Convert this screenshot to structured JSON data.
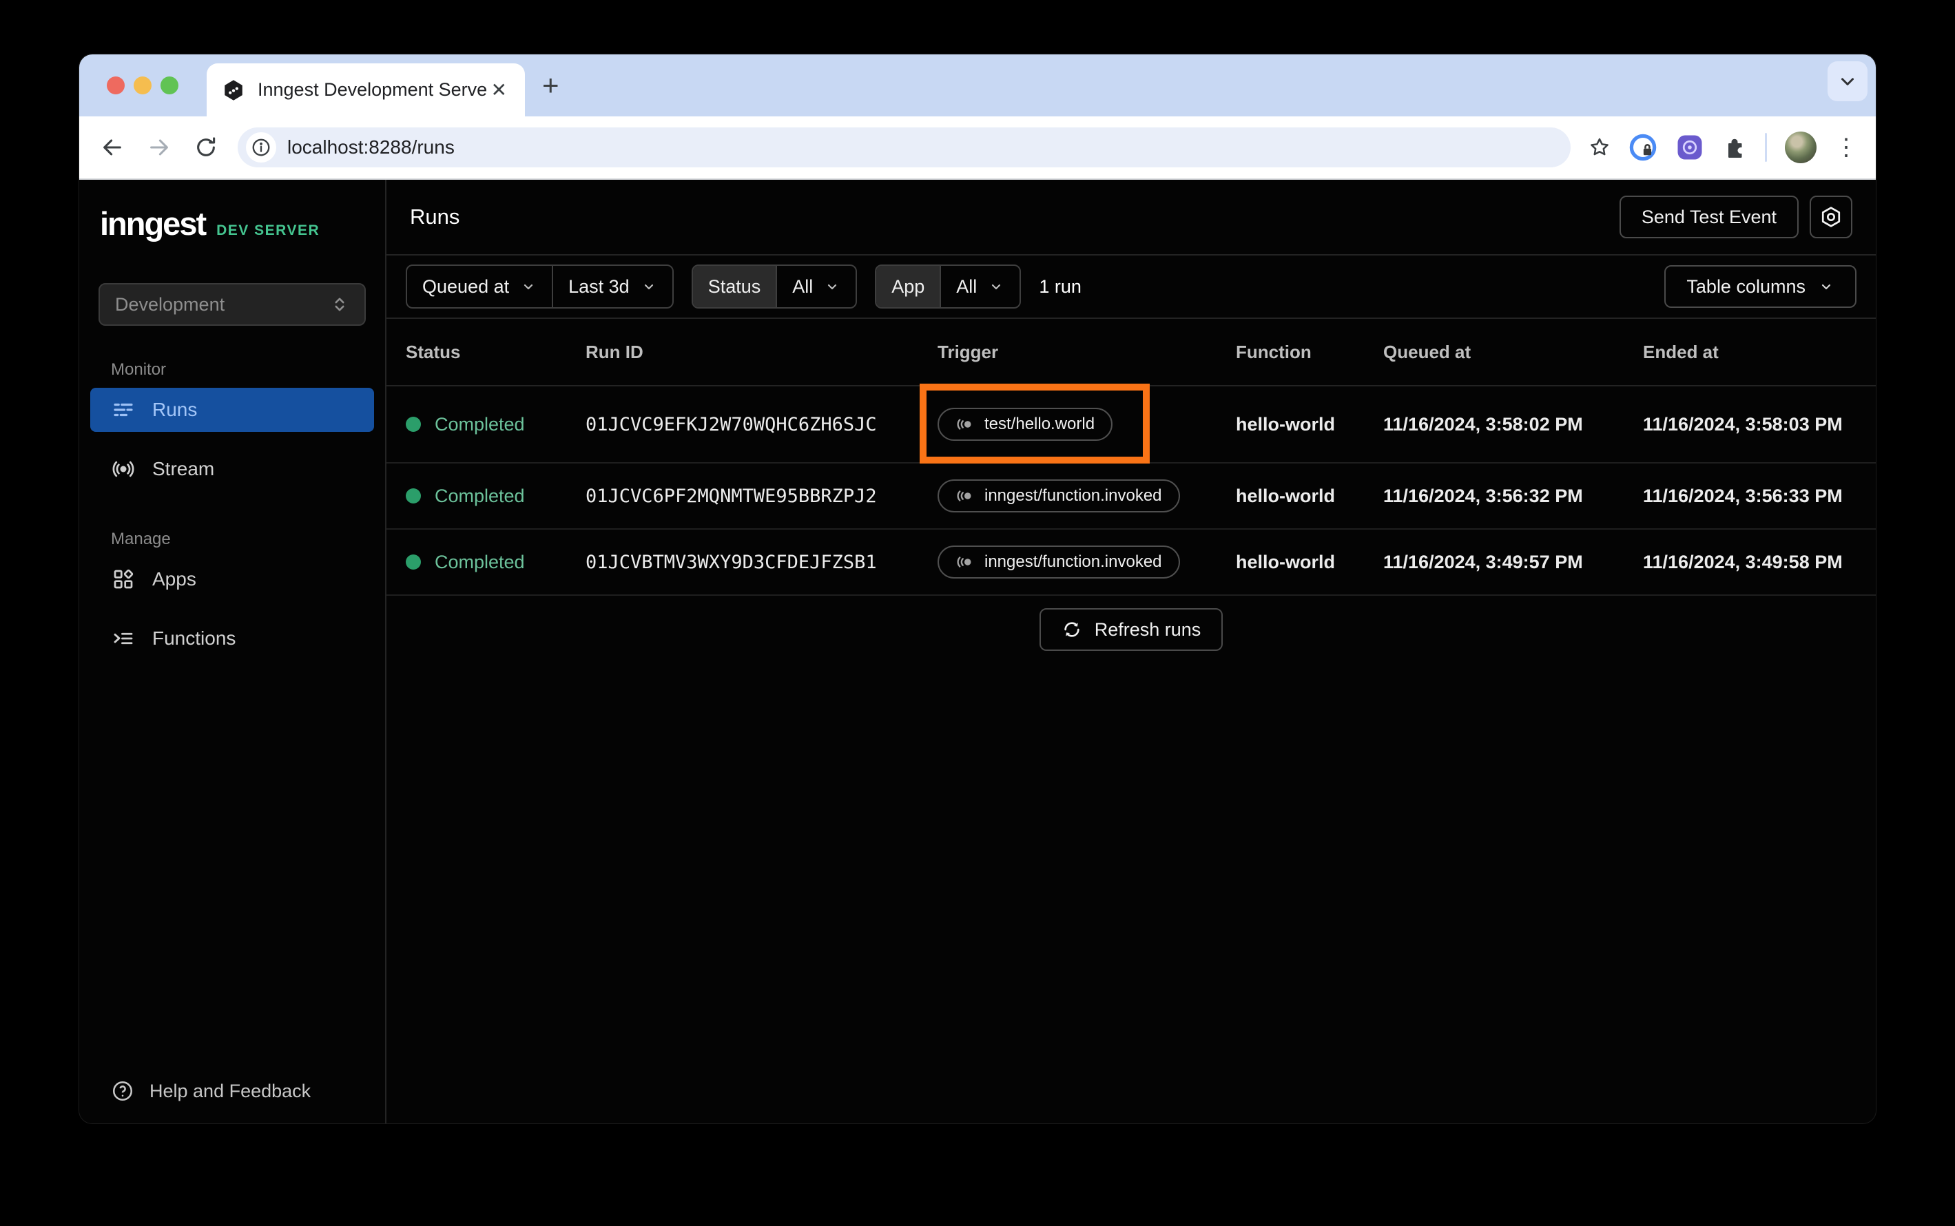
{
  "browser": {
    "tab_title": "Inngest Development Server",
    "url": "localhost:8288/runs",
    "icons": {
      "tab_close": "✕",
      "new_tab": "+",
      "overflow_menu": "⋮"
    }
  },
  "sidebar": {
    "logo": "inngest",
    "badge": "DEV SERVER",
    "env_selector": {
      "value": "Development"
    },
    "monitor_label": "Monitor",
    "manage_label": "Manage",
    "items": {
      "runs": "Runs",
      "stream": "Stream",
      "apps": "Apps",
      "functions": "Functions"
    },
    "help": "Help and Feedback"
  },
  "header": {
    "title": "Runs",
    "send_test_event": "Send Test Event"
  },
  "filters": {
    "queued_at": "Queued at",
    "range": "Last 3d",
    "status_label": "Status",
    "status_value": "All",
    "app_label": "App",
    "app_value": "All",
    "count": "1 run",
    "table_columns": "Table columns"
  },
  "table": {
    "columns": [
      "Status",
      "Run ID",
      "Trigger",
      "Function",
      "Queued at",
      "Ended at"
    ],
    "rows": [
      {
        "status": "Completed",
        "run_id": "01JCVC9EFKJ2W70WQHC6ZH6SJC",
        "trigger": "test/hello.world",
        "function": "hello-world",
        "queued_at": "11/16/2024, 3:58:02 PM",
        "ended_at": "11/16/2024, 3:58:03 PM",
        "highlighted": true
      },
      {
        "status": "Completed",
        "run_id": "01JCVC6PF2MQNMTWE95BBRZPJ2",
        "trigger": "inngest/function.invoked",
        "function": "hello-world",
        "queued_at": "11/16/2024, 3:56:32 PM",
        "ended_at": "11/16/2024, 3:56:33 PM",
        "highlighted": false
      },
      {
        "status": "Completed",
        "run_id": "01JCVBTMV3WXY9D3CFDEJFZSB1",
        "trigger": "inngest/function.invoked",
        "function": "hello-world",
        "queued_at": "11/16/2024, 3:49:57 PM",
        "ended_at": "11/16/2024, 3:49:58 PM",
        "highlighted": false
      }
    ],
    "refresh": "Refresh runs"
  },
  "colors": {
    "annotation_orange": "#F97316",
    "active_nav_blue": "#15509F",
    "status_green_dot": "#2B9E6A",
    "status_green_text": "#6CC29B",
    "dev_badge_green": "#45C590",
    "tabstrip_blue": "#C8D8F3"
  }
}
